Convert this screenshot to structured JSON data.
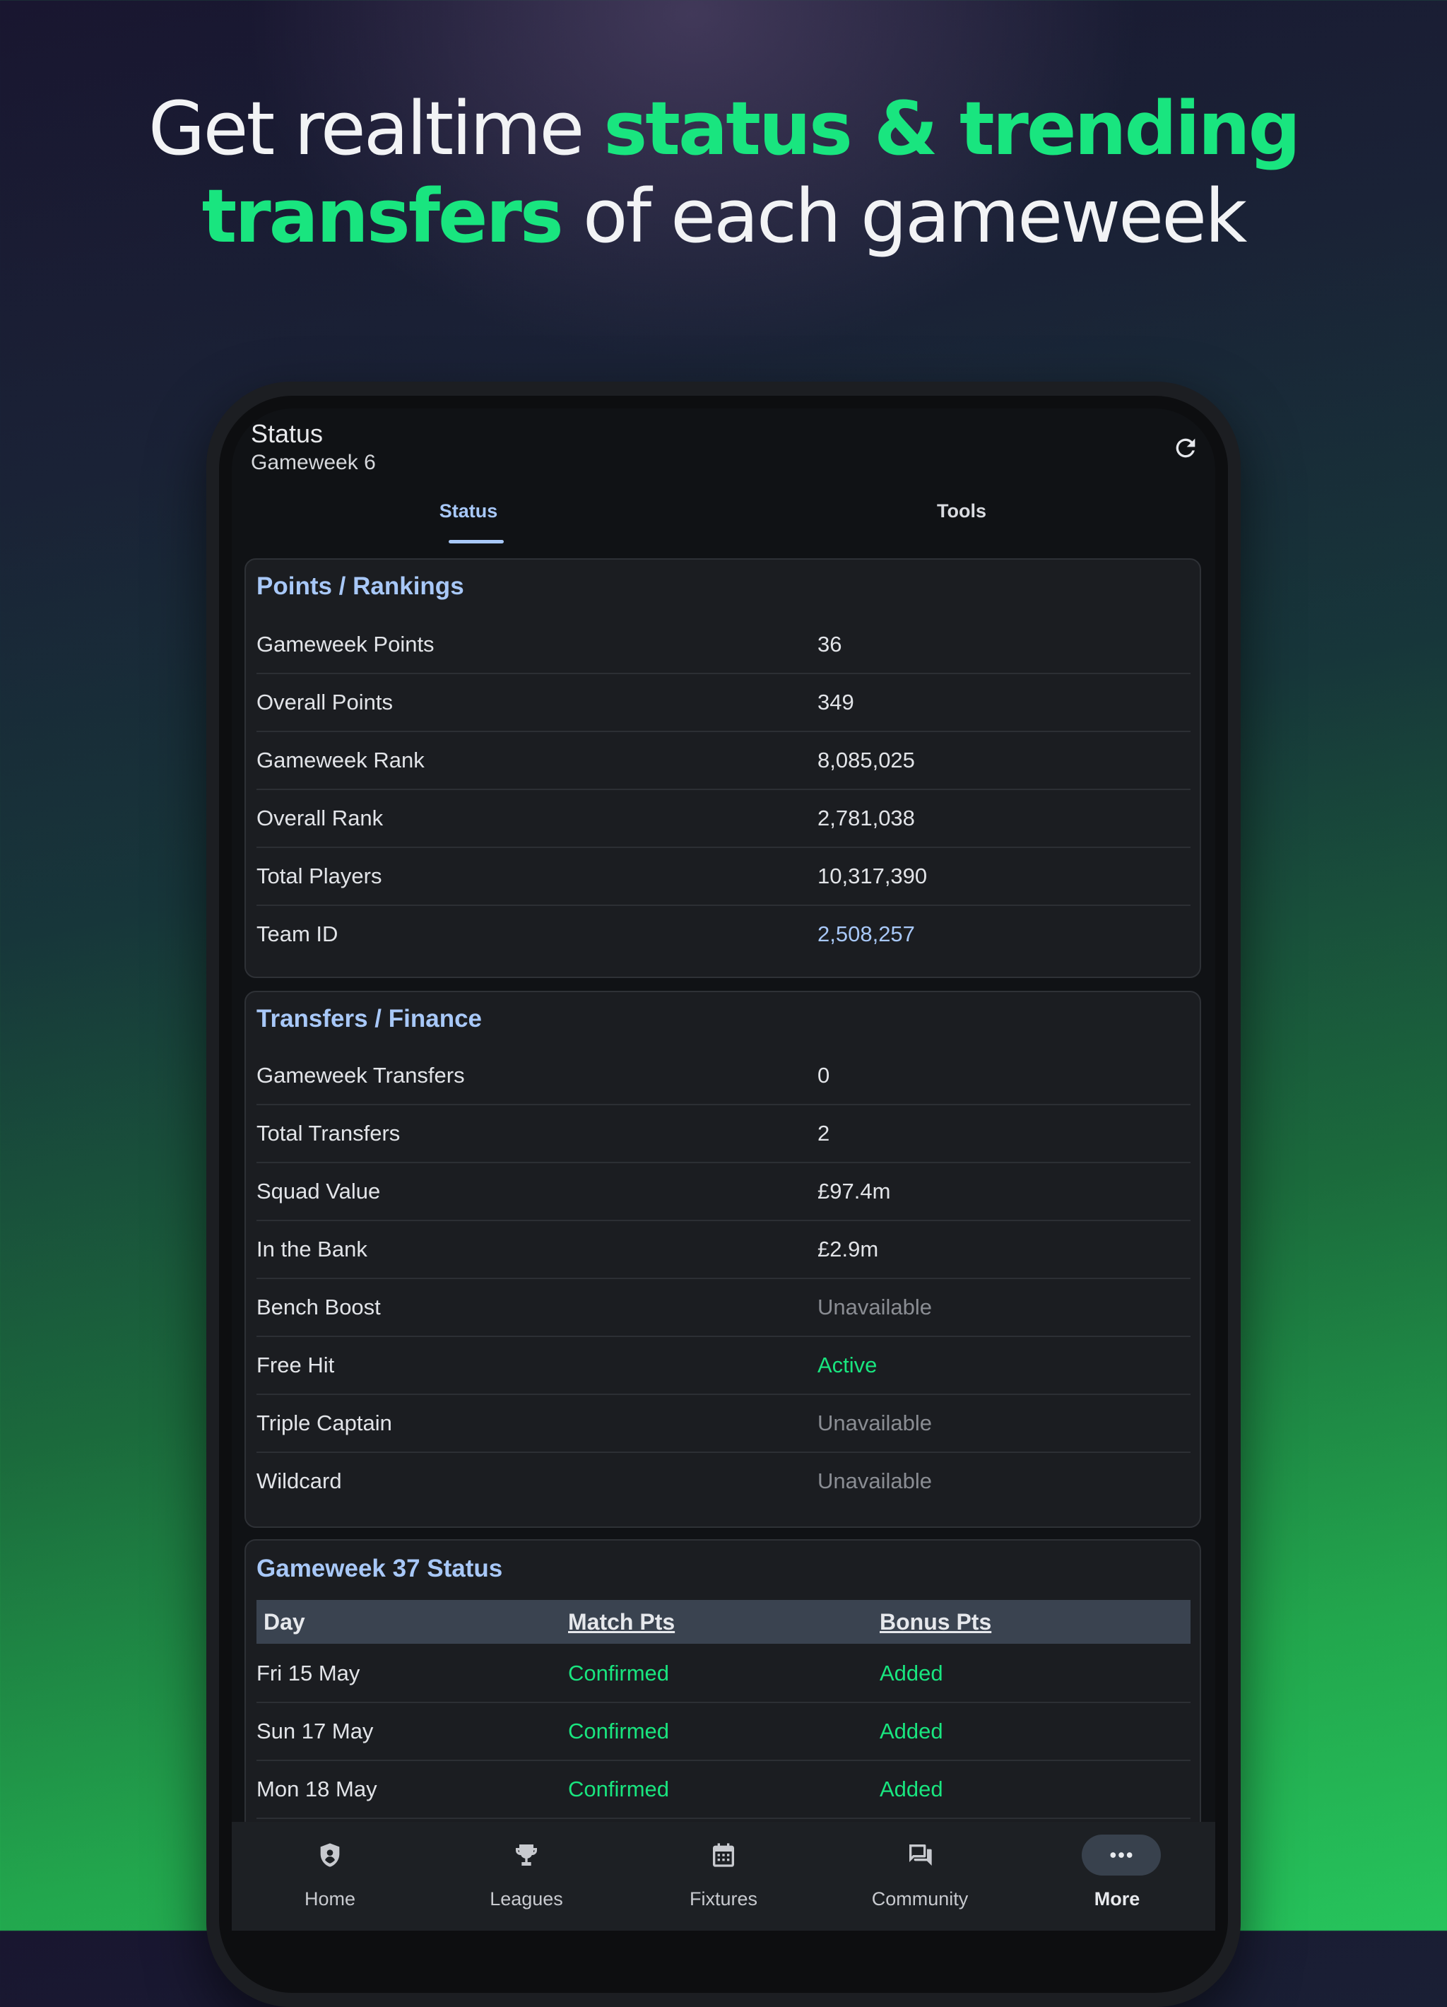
{
  "headline": {
    "part1": "Get realtime ",
    "highlight1": "status & trending",
    "highlight2": "transfers",
    "part2": " of each gameweek"
  },
  "appbar": {
    "title": "Status",
    "subtitle": "Gameweek 6",
    "refresh_icon": "refresh-icon"
  },
  "tabs": [
    {
      "label": "Status",
      "selected": true
    },
    {
      "label": "Tools",
      "selected": false
    }
  ],
  "points_card": {
    "title": "Points / Rankings",
    "rows": [
      {
        "label": "Gameweek Points",
        "value": "36"
      },
      {
        "label": "Overall Points",
        "value": "349"
      },
      {
        "label": "Gameweek Rank",
        "value": "8,085,025"
      },
      {
        "label": "Overall Rank",
        "value": "2,781,038"
      },
      {
        "label": "Total Players",
        "value": "10,317,390"
      },
      {
        "label": "Team ID",
        "value": "2,508,257"
      }
    ]
  },
  "transfers_card": {
    "title": "Transfers / Finance",
    "rows": [
      {
        "label": "Gameweek Transfers",
        "value": "0"
      },
      {
        "label": "Total Transfers",
        "value": "2"
      },
      {
        "label": "Squad Value",
        "value": "£97.4m"
      },
      {
        "label": "In the Bank",
        "value": "£2.9m"
      },
      {
        "label": "Bench Boost",
        "value": "Unavailable"
      },
      {
        "label": "Free Hit",
        "value": "Active"
      },
      {
        "label": "Triple Captain",
        "value": "Unavailable"
      },
      {
        "label": "Wildcard",
        "value": "Unavailable"
      }
    ]
  },
  "gw_status_card": {
    "title": "Gameweek 37 Status",
    "headers": [
      "Day",
      "Match Pts",
      "Bonus Pts"
    ],
    "rows": [
      {
        "day": "Fri 15 May",
        "match": "Confirmed",
        "bonus": "Added"
      },
      {
        "day": "Sun 17 May",
        "match": "Confirmed",
        "bonus": "Added"
      },
      {
        "day": "Mon 18 May",
        "match": "Confirmed",
        "bonus": "Added"
      }
    ]
  },
  "nav": [
    {
      "label": "Home",
      "icon": "shield-icon"
    },
    {
      "label": "Leagues",
      "icon": "trophy-icon"
    },
    {
      "label": "Fixtures",
      "icon": "calendar-icon"
    },
    {
      "label": "Community",
      "icon": "chat-icon"
    },
    {
      "label": "More",
      "icon": "more-icon",
      "selected": true
    }
  ],
  "colors": {
    "accent_green": "#19e57f",
    "accent_blue": "#a8c8f8",
    "card_bg": "#1b1d21",
    "muted": "#8a8d93"
  }
}
